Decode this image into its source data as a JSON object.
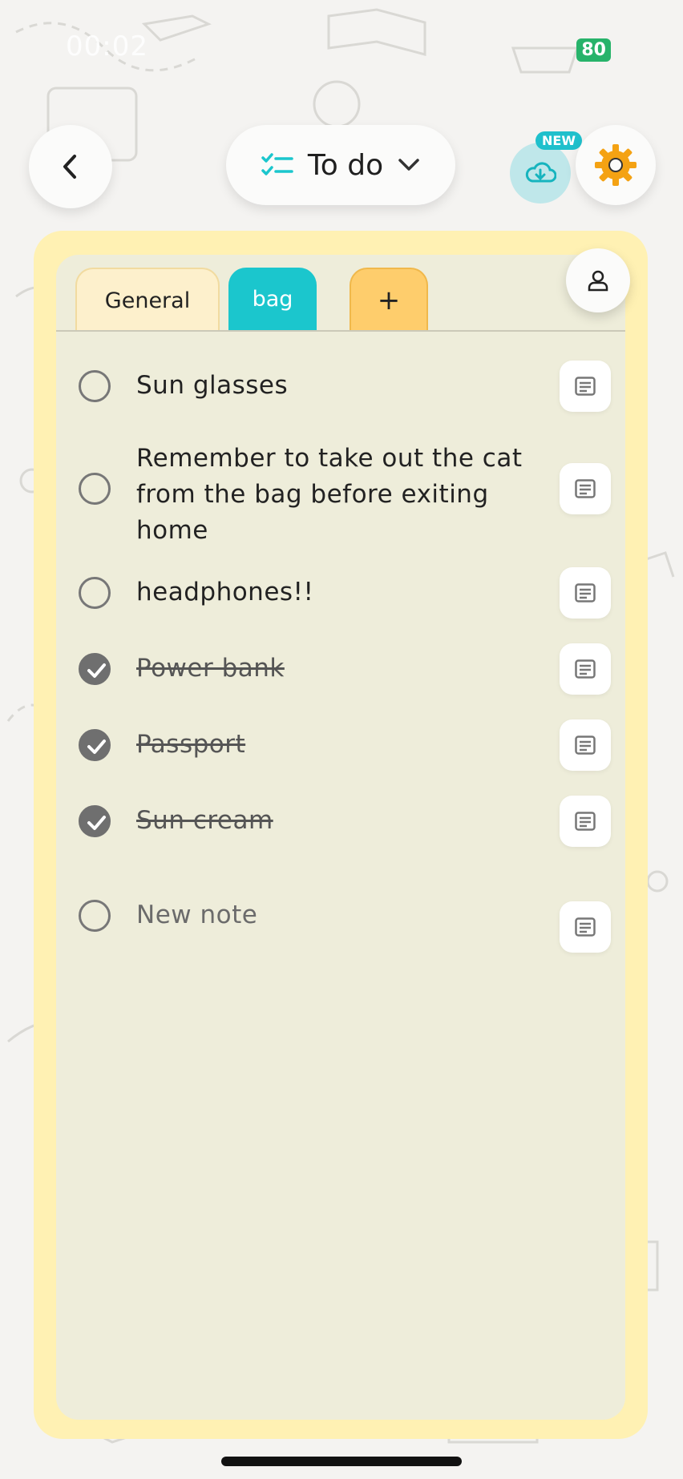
{
  "status_bar": {
    "time": "00:02",
    "battery": "80"
  },
  "header": {
    "title": "To do",
    "new_badge": "NEW"
  },
  "tabs": [
    {
      "label": "General"
    },
    {
      "label": "bag",
      "active": true
    },
    {
      "label": "+"
    }
  ],
  "items": [
    {
      "text": "Sun glasses",
      "done": false
    },
    {
      "text": "Remember to take out the cat from the bag before exiting home",
      "done": false
    },
    {
      "text": "headphones!!",
      "done": false
    },
    {
      "text": "Power bank",
      "done": true
    },
    {
      "text": "Passport",
      "done": true
    },
    {
      "text": "Sun cream",
      "done": true
    }
  ],
  "new_note_placeholder": "New note",
  "colors": {
    "accent_teal": "#1bc6cd",
    "tab_add": "#fecd6c",
    "card_border": "#fff1b3",
    "settings_gear": "#f4a213"
  }
}
